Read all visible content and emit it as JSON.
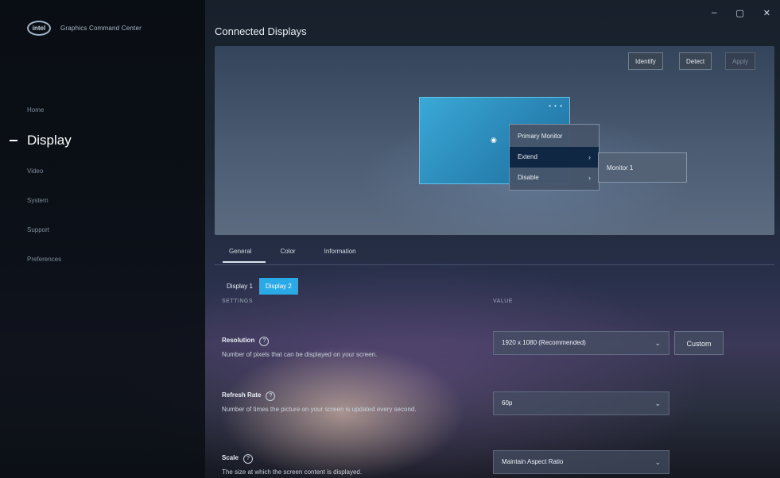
{
  "app": {
    "logo_text": "intel",
    "name": "Graphics Command Center"
  },
  "window_controls": {
    "minimize": "–",
    "maximize": "▢",
    "close": "✕"
  },
  "sidebar": {
    "items": [
      {
        "label": "Home"
      },
      {
        "label": "Display"
      },
      {
        "label": "Video"
      },
      {
        "label": "System"
      },
      {
        "label": "Support"
      },
      {
        "label": "Preferences"
      }
    ],
    "active": "Display"
  },
  "main": {
    "title": "Connected Displays",
    "preview_buttons": {
      "identify": "Identify",
      "detect": "Detect",
      "apply": "Apply"
    },
    "monitor": {
      "dots": "• • •",
      "icon": "◉"
    },
    "context_menu": {
      "items": [
        {
          "label": "Primary Monitor",
          "has_submenu": false
        },
        {
          "label": "Extend",
          "has_submenu": true
        },
        {
          "label": "Disable",
          "has_submenu": true
        }
      ],
      "arrow": "›",
      "highlighted_index": 1
    },
    "submenu": {
      "items": [
        "Monitor 1"
      ]
    },
    "tabs": [
      {
        "label": "General"
      },
      {
        "label": "Color"
      },
      {
        "label": "Information"
      }
    ],
    "active_tab": "General",
    "display_tabs": [
      {
        "label": "Display 1"
      },
      {
        "label": "Display 2"
      }
    ],
    "active_display": "Display 2",
    "column_headers": {
      "settings": "SETTINGS",
      "value": "VALUE"
    },
    "settings": [
      {
        "name": "Resolution",
        "desc": "Number of pixels that can be displayed on your screen.",
        "value": "1920 x 1080 (Recommended)"
      },
      {
        "name": "Refresh Rate",
        "desc": "Number of times the picture on your screen is updated every second.",
        "value": "60p"
      },
      {
        "name": "Scale",
        "desc": "The size at which the screen content is displayed.",
        "value": "Maintain Aspect Ratio"
      }
    ],
    "custom_label": "Custom",
    "help_glyph": "?",
    "chevron_glyph": "⌄"
  }
}
